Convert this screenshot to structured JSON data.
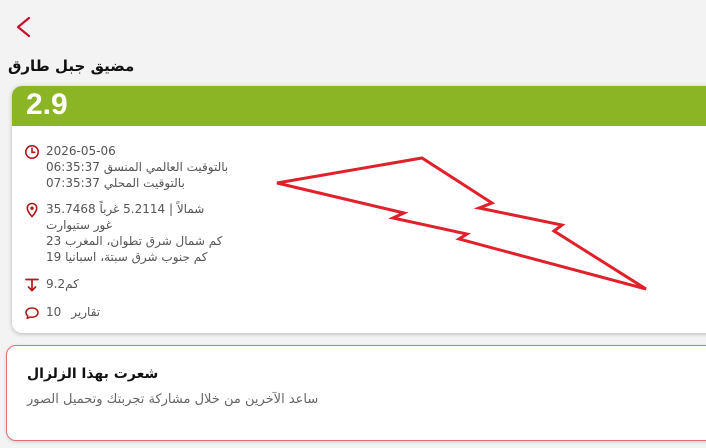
{
  "header": {
    "back_icon": "chevron-left-icon",
    "title": "مضيق جبل طارق"
  },
  "colors": {
    "accent": "#c8102e",
    "magnitude_bar": "#8cb526"
  },
  "event": {
    "magnitude": "2.9",
    "date": "2026-05-06",
    "utc_time": "06:35:37 بالتوقيت العالمي المنسق",
    "local_time": "07:35:37 بالتوقيت المحلي",
    "coordinates": "35.7468 شمالاً | 5.2114 غرباً",
    "region": "غور ستيوارت",
    "nearby_1": "23 كم شمال شرق تطوان، المغرب",
    "nearby_2": "19 كم جنوب شرق سبتة، اسبانيا",
    "depth": "9.2كم",
    "reports_label": "تقارير",
    "reports_count": "10",
    "icons": {
      "time": "clock-icon",
      "location": "location-pin-icon",
      "depth": "depth-arrow-icon",
      "reports": "comment-icon",
      "map": "lightning-bolt-icon"
    }
  },
  "felt": {
    "title": "شعرت بهذا الزلزال",
    "subtitle": "ساعد الآخرين من خلال مشاركة تجربتك وتحميل الصور"
  }
}
